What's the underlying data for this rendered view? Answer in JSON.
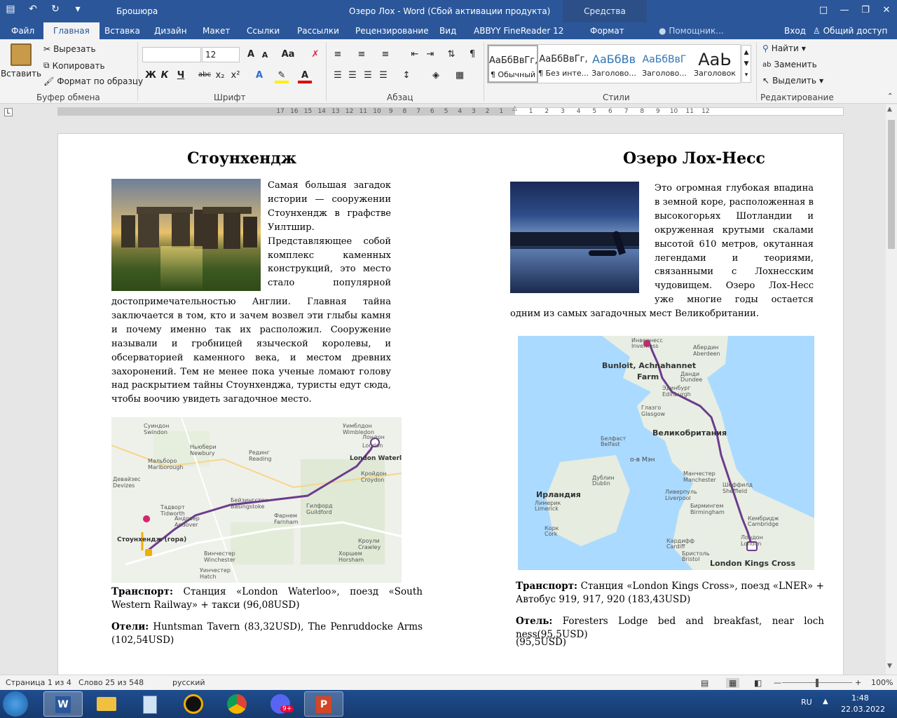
{
  "window": {
    "doc_name": "Брошюра",
    "title": "Озеро Лох - Word (Сбой активации продукта)",
    "context_tab": "Средства рисования"
  },
  "tabs": [
    "Файл",
    "Главная",
    "Вставка",
    "Дизайн",
    "Макет",
    "Ссылки",
    "Рассылки",
    "Рецензирование",
    "Вид",
    "ABBYY FineReader 12",
    "Формат",
    "Помощник...",
    "Вход",
    "Общий доступ"
  ],
  "ribbon": {
    "clipboard": {
      "paste": "Вставить",
      "cut": "Вырезать",
      "copy": "Копировать",
      "format_painter": "Формат по образцу",
      "label": "Буфер обмена"
    },
    "font": {
      "name": "",
      "size": "12",
      "label": "Шрифт",
      "bold": "Ж",
      "italic": "К",
      "underline": "Ч",
      "strike": "abc",
      "sub": "x₂",
      "sup": "x²",
      "case": "Aa",
      "grow": "A",
      "shrink": "A"
    },
    "paragraph": {
      "label": "Абзац",
      "pilcrow": "¶"
    },
    "styles": {
      "label": "Стили",
      "items": [
        {
          "preview": "АаБбВвГг,",
          "name": "¶ Обычный"
        },
        {
          "preview": "АаБбВвГг,",
          "name": "¶ Без инте..."
        },
        {
          "preview": "АаБбВв",
          "name": "Заголово..."
        },
        {
          "preview": "АаБбВвГ",
          "name": "Заголово..."
        },
        {
          "preview": "АаЬ",
          "name": "Заголовок"
        }
      ]
    },
    "editing": {
      "find": "Найти",
      "replace": "Заменить",
      "select": "Выделить",
      "label": "Редактирование"
    }
  },
  "ruler": {
    "left_numbers": [
      "17",
      "16",
      "15",
      "14",
      "13",
      "12",
      "11",
      "10",
      "9",
      "8",
      "7",
      "6",
      "5",
      "4",
      "3",
      "2",
      "1"
    ],
    "right_numbers": [
      "1",
      "2",
      "3",
      "4",
      "5",
      "6",
      "7",
      "8",
      "9",
      "10",
      "11",
      "12"
    ]
  },
  "document": {
    "left": {
      "title": "Стоунхендж",
      "paragraph": " Самая большая загадок истории — сооружении Стоунхендж в графстве Уилтшир. Представляющее собой комплекс каменных конструкций, это место стало популярной достопримечательностью Англии. Главная тайна заключается в том, кто и зачем возвел эти глыбы камня и почему именно так их расположил. Сооружение называли и гробницей языческой королевы, и обсерваторией каменного века, и местом древних захоронений. Тем не менее пока ученые ломают голову над раскрытием тайны Стоунхенджа, туристы едут сюда, чтобы воочию увидеть загадочное место.",
      "map_labels": [
        "Лондон",
        "London",
        "London Waterloo",
        "Стоунхендж (гора)",
        "Суиндон",
        "Swindon",
        "Мальборо",
        "Marlborough",
        "Рединг",
        "Reading",
        "Уимблдон",
        "Wimbledon",
        "Кройдон",
        "Croydon",
        "Андовер",
        "Andover",
        "Бейзингсток",
        "Basingstoke",
        "Гилфорд",
        "Guildford",
        "Винчестер",
        "Winchester",
        "Хоршем",
        "Horsham",
        "Кроули",
        "Crawley",
        "Фарнем",
        "Farnham",
        "Девайзес",
        "Devizes",
        "Тадворт",
        "Tidworth",
        "Ньюбери",
        "Newbury",
        "Уинчестер",
        "Hatch"
      ],
      "transport_label": "Транспорт:",
      "transport": " Станция «London Waterloo», поезд «South Western Railway» + такси (96,08USD)",
      "hotels_label": "Отели:",
      "hotels": " Huntsman Tavern (83,32USD), The Penruddocke Arms (102,54USD)"
    },
    "right": {
      "title": "Озеро Лох-Несс",
      "paragraph": "Это огромная глубокая впадина в земной коре, расположенная в высокогорьях Шотландии и окруженная крутыми скалами высотой 610 метров, окутанная легендами и теориями, связанными с Лохнесским чудовищем. Озеро Лох-Несс уже многие годы остается одним из самых загадочных мест Великобритании.",
      "map_labels": [
        "Инвернесс",
        "Inverness",
        "Bunloit, Achnahannet",
        "Farm",
        "Абердин",
        "Aberdeen",
        "Данди",
        "Dundee",
        "Эдинбург",
        "Edinburgh",
        "Глазго",
        "Glasgow",
        "Великобритания",
        "Белфаст",
        "Belfast",
        "о-в Мэн",
        "Ирландия",
        "Дублин",
        "Dublin",
        "Манчестер",
        "Manchester",
        "Шеффилд",
        "Sheffield",
        "Ливерпуль",
        "Liverpool",
        "Бирмингем",
        "Birmingham",
        "Лимерик",
        "Limerick",
        "Корк",
        "Cork",
        "Кардифф",
        "Cardiff",
        "Бристоль",
        "Bristol",
        "Кембридж",
        "Cambridge",
        "Лондон",
        "London",
        "London Kings Cross"
      ],
      "transport_label": "Транспорт:",
      "transport": " Станция «London Kings Cross», поезд «LNER» + Автобус 919, 917, 920 (183,43USD)",
      "hotels_label": "Отель:",
      "hotels": " Foresters Lodge bed and breakfast, near loch ness(95,5USD)",
      "extra": "(95,5USD)"
    }
  },
  "statusbar": {
    "page": "Страница 1 из 4",
    "words": "Слово 25 из 548",
    "lang": "русский",
    "zoom": "100%",
    "zoom_level": 1.0
  },
  "taskbar": {
    "lang": "RU",
    "time": "1:48",
    "date": "22.03.2022",
    "badge": "9+"
  }
}
